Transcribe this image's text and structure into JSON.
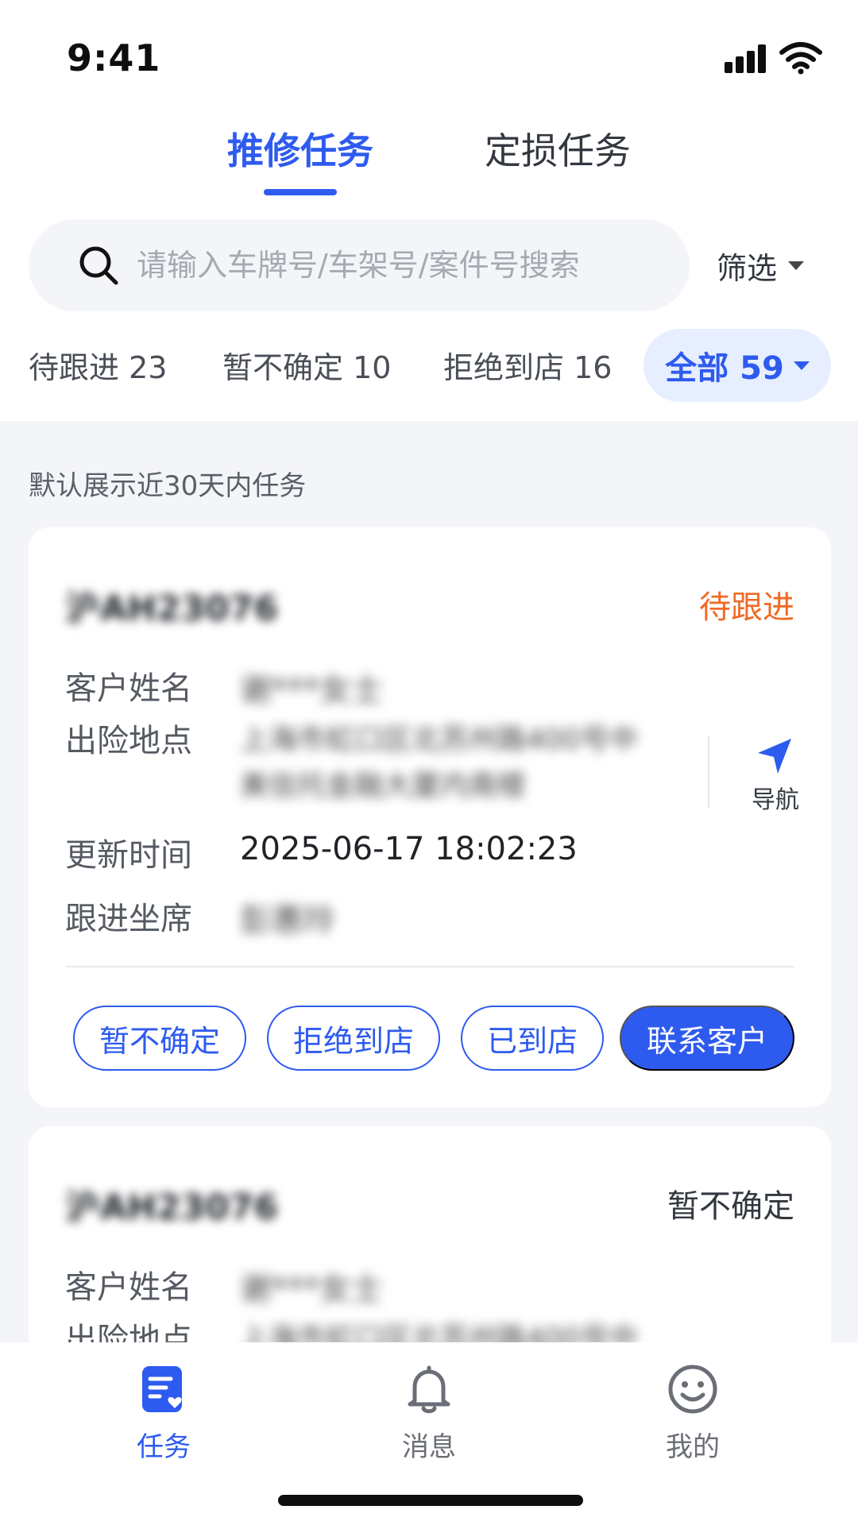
{
  "status_bar": {
    "time": "9:41"
  },
  "tabs": [
    {
      "label": "推修任务",
      "active": true
    },
    {
      "label": "定损任务",
      "active": false
    }
  ],
  "search": {
    "placeholder": "请输入车牌号/车架号/案件号搜索",
    "value": ""
  },
  "filter": {
    "label": "筛选"
  },
  "status_chips": [
    {
      "label": "待跟进 23"
    },
    {
      "label": "暂不确定 10"
    },
    {
      "label": "拒绝到店 16"
    },
    {
      "label": "全部 59",
      "active": true
    }
  ],
  "hint": "默认展示近30天内任务",
  "labels": {
    "customer_name": "客户姓名",
    "incident_location": "出险地点",
    "update_time": "更新时间",
    "agent": "跟进坐席",
    "navigate": "导航"
  },
  "tasks": [
    {
      "plate": "沪AH23076",
      "status": "待跟进",
      "customer_name": "谢***女士",
      "location_line1": "上海市虹口区北苏州路400号中",
      "location_line2": "美信托金融大厦内南楼",
      "update_time": "2025-06-17 18:02:23",
      "agent": "彭惠玲",
      "actions": [
        "暂不确定",
        "拒绝到店",
        "已到店",
        "联系客户"
      ]
    },
    {
      "plate": "沪AH23076",
      "status": "暂不确定",
      "customer_name": "谢***女士",
      "location_line1": "上海市虹口区北苏州路400号中"
    }
  ],
  "tabbar": [
    {
      "label": "任务",
      "active": true
    },
    {
      "label": "消息",
      "active": false
    },
    {
      "label": "我的",
      "active": false
    }
  ],
  "colors": {
    "accent": "#2E5BEF",
    "pending": "#F06A25",
    "background": "#F4F5F9",
    "chip_active_bg": "#E6EEFF"
  }
}
